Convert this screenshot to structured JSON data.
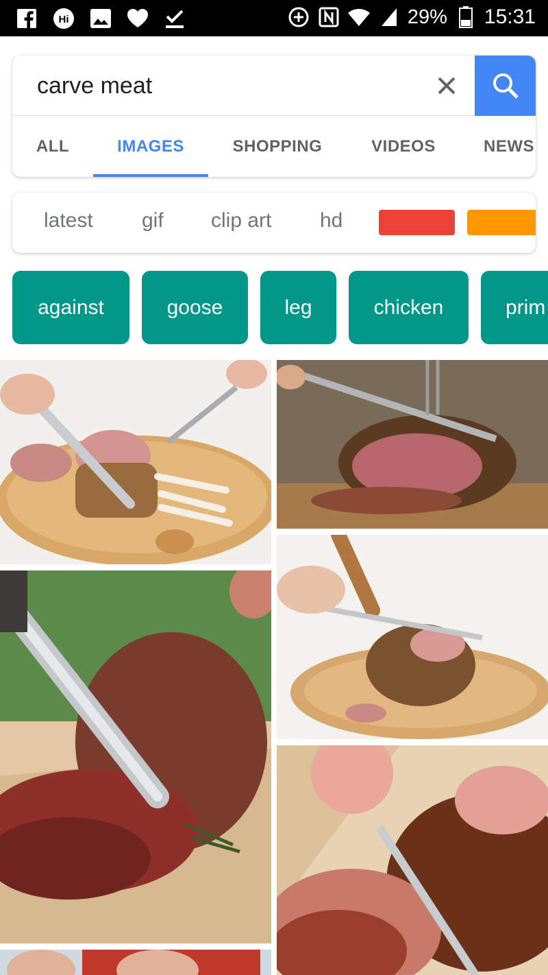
{
  "status_bar": {
    "battery": "29%",
    "time": "15:31",
    "icons": [
      "facebook-icon",
      "hd-icon",
      "gallery-icon",
      "heart-icon",
      "download-done-icon",
      "data-saver-icon",
      "nfc-icon",
      "wifi-icon",
      "signal-icon",
      "battery-icon"
    ]
  },
  "search": {
    "query": "carve meat",
    "clear_icon": "close-icon",
    "search_icon": "search-icon",
    "accent": "#4285f4"
  },
  "tabs": [
    {
      "label": "ALL",
      "active": false
    },
    {
      "label": "IMAGES",
      "active": true
    },
    {
      "label": "SHOPPING",
      "active": false
    },
    {
      "label": "VIDEOS",
      "active": false
    },
    {
      "label": "NEWS",
      "active": false
    }
  ],
  "filters": {
    "labels": [
      "latest",
      "gif",
      "clip art",
      "hd"
    ],
    "color_swatches": [
      "#ea4335",
      "#ff9800"
    ]
  },
  "chips": {
    "labels": [
      "against",
      "goose",
      "leg",
      "chicken",
      "prim"
    ],
    "color": "#009688"
  },
  "images": [
    {
      "subject": "rack of lamb carved on wooden board"
    },
    {
      "subject": "prime rib roast being sliced"
    },
    {
      "subject": "roast beef being sliced with large knife"
    },
    {
      "subject": "leg of lamb carved on round board"
    },
    {
      "subject": "roast meat carved with knife"
    }
  ]
}
